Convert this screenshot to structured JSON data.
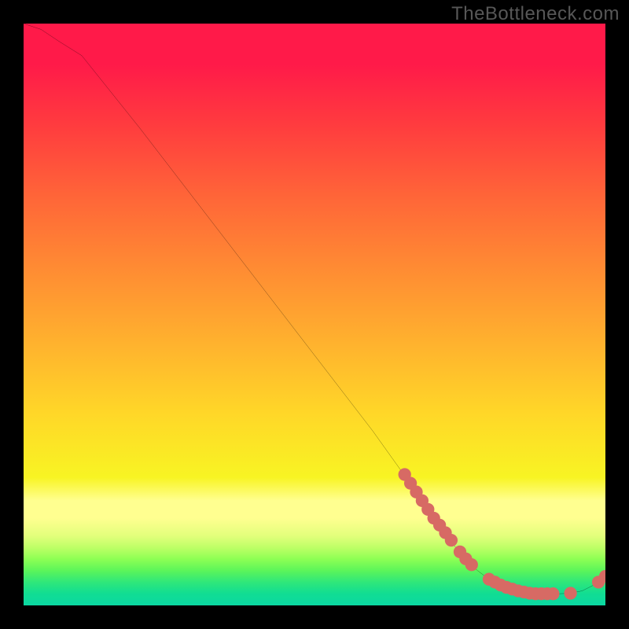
{
  "watermark": "TheBottleneck.com",
  "chart_data": {
    "type": "line",
    "title": "",
    "xlabel": "",
    "ylabel": "",
    "xlim": [
      0,
      100
    ],
    "ylim": [
      0,
      100
    ],
    "grid": false,
    "legend": false,
    "series": [
      {
        "name": "curve",
        "color": "#000000",
        "x": [
          0,
          3,
          6,
          10,
          20,
          30,
          40,
          50,
          60,
          65,
          70,
          75,
          78,
          80,
          83,
          86,
          88,
          90,
          92,
          94,
          96,
          98,
          100
        ],
        "y": [
          100,
          99,
          97,
          94.5,
          82,
          69,
          56,
          43,
          30,
          23,
          15.5,
          9,
          6,
          4.5,
          3,
          2.2,
          2,
          2,
          2,
          2.1,
          2.5,
          3.5,
          5
        ]
      }
    ],
    "markers": [
      {
        "name": "highlight-points",
        "color": "#d76a64",
        "shape": "circle",
        "r": 1.1,
        "points": [
          {
            "x": 65.5,
            "y": 22.5
          },
          {
            "x": 66.5,
            "y": 21
          },
          {
            "x": 67.5,
            "y": 19.5
          },
          {
            "x": 68.5,
            "y": 18
          },
          {
            "x": 69.5,
            "y": 16.5
          },
          {
            "x": 70.5,
            "y": 15
          },
          {
            "x": 71.5,
            "y": 13.8
          },
          {
            "x": 72.5,
            "y": 12.5
          },
          {
            "x": 73.5,
            "y": 11.2
          },
          {
            "x": 75,
            "y": 9.2
          },
          {
            "x": 76,
            "y": 8
          },
          {
            "x": 77,
            "y": 7
          },
          {
            "x": 80,
            "y": 4.5
          },
          {
            "x": 81,
            "y": 4
          },
          {
            "x": 82,
            "y": 3.5
          },
          {
            "x": 83,
            "y": 3.1
          },
          {
            "x": 84,
            "y": 2.8
          },
          {
            "x": 85,
            "y": 2.5
          },
          {
            "x": 86,
            "y": 2.3
          },
          {
            "x": 87,
            "y": 2.1
          },
          {
            "x": 88,
            "y": 2
          },
          {
            "x": 89,
            "y": 2
          },
          {
            "x": 90,
            "y": 2
          },
          {
            "x": 91,
            "y": 2
          },
          {
            "x": 94,
            "y": 2.1
          },
          {
            "x": 98.8,
            "y": 4
          },
          {
            "x": 100,
            "y": 5
          }
        ]
      }
    ],
    "background": {
      "type": "vertical-gradient",
      "stops": [
        {
          "pos": 0,
          "color": "#ff1a49"
        },
        {
          "pos": 0.5,
          "color": "#ffb22e"
        },
        {
          "pos": 0.78,
          "color": "#f8f423"
        },
        {
          "pos": 0.84,
          "color": "#ffff90"
        },
        {
          "pos": 1,
          "color": "#0bd8a2"
        }
      ]
    }
  }
}
